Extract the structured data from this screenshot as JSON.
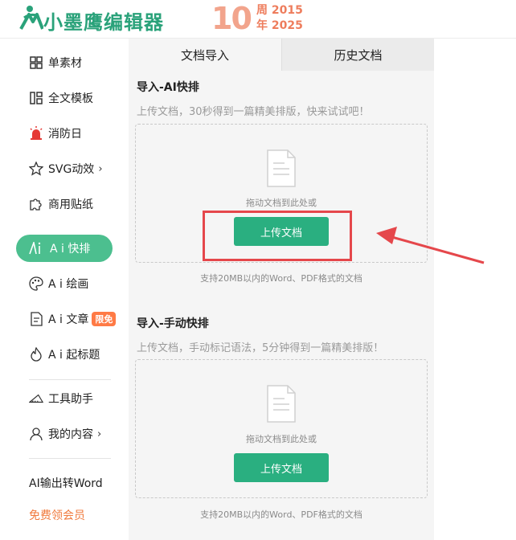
{
  "header": {
    "logo_text": "小墨鹰编辑器",
    "anniversary": {
      "number": "10",
      "line1": "周 2015",
      "line2": "年 2025"
    }
  },
  "sidebar": {
    "items": [
      {
        "label": "单素材",
        "icon": "grid-icon"
      },
      {
        "label": "全文模板",
        "icon": "template-icon"
      },
      {
        "label": "消防日",
        "icon": "siren-icon"
      },
      {
        "label": "SVG动效",
        "icon": "star-icon",
        "chevron": "›"
      },
      {
        "label": "商用贴纸",
        "icon": "puzzle-icon"
      },
      {
        "label": "A i 快排",
        "icon": "ai-icon"
      },
      {
        "label": "A i 绘画",
        "icon": "palette-icon"
      },
      {
        "label": "A i 文章",
        "icon": "article-icon",
        "badge": "限免"
      },
      {
        "label": "A i 起标题",
        "icon": "flame-icon"
      },
      {
        "label": "工具助手",
        "icon": "tools-icon"
      },
      {
        "label": "我的内容",
        "icon": "user-icon",
        "chevron": "›"
      },
      {
        "label": "AI输出转Word"
      },
      {
        "label": "免费领会员"
      }
    ]
  },
  "tabs": [
    {
      "label": "文档导入",
      "active": true
    },
    {
      "label": "历史文档",
      "active": false
    }
  ],
  "sections": [
    {
      "title": "导入-AI快排",
      "desc": "上传文档，30秒得到一篇精美排版，快来试试吧！",
      "drop_hint": "拖动文档到此处或",
      "button": "上传文档",
      "note": "支持20MB以内的Word、PDF格式的文档"
    },
    {
      "title": "导入-手动快排",
      "desc": "上传文档，手动标记语法，5分钟得到一篇精美排版！",
      "drop_hint": "拖动文档到此处或",
      "button": "上传文档",
      "note": "支持20MB以内的Word、PDF格式的文档"
    }
  ],
  "colors": {
    "brand": "#2aa27a",
    "button": "#2aaf80",
    "active_nav": "#4cbf8f",
    "highlight": "#e5474b",
    "badge": "#ff7a45"
  }
}
